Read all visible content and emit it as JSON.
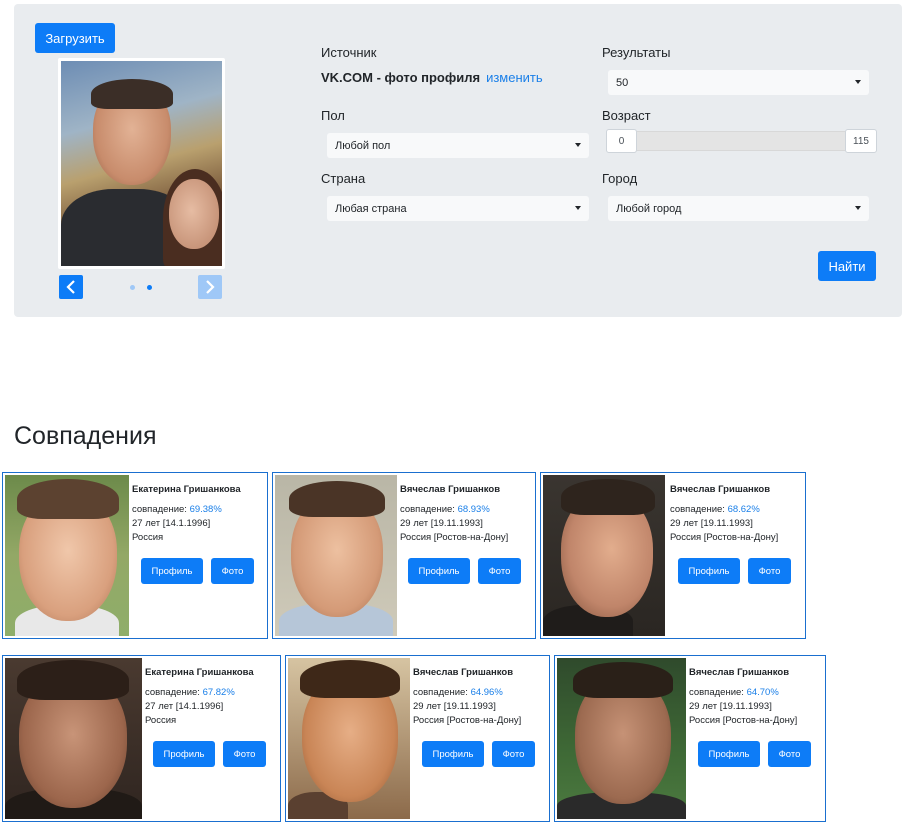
{
  "upload": {
    "label": "Загрузить"
  },
  "carousel": {
    "prev_icon": "chevron-left-icon",
    "next_icon": "chevron-right-icon",
    "dots": 2,
    "active_dot": 1
  },
  "search": {
    "source_label": "Источник",
    "source_value": "VK.COM - фото профиля",
    "source_change": "изменить",
    "results_label": "Результаты",
    "results_value": "50",
    "gender_label": "Пол",
    "gender_value": "Любой пол",
    "age_label": "Возраст",
    "age_min": "0",
    "age_max": "115",
    "country_label": "Страна",
    "country_value": "Любая страна",
    "city_label": "Город",
    "city_value": "Любой город",
    "find_label": "Найти"
  },
  "matches": {
    "heading": "Совпадения",
    "match_prefix": "совпадение:",
    "profile_label": "Профиль",
    "photo_label": "Фото",
    "items": [
      {
        "name": "Екатерина Гришанкова",
        "match": "69.38%",
        "age": "27 лет [14.1.1996]",
        "location": "Россия"
      },
      {
        "name": "Вячеслав Гришанков",
        "match": "68.93%",
        "age": "29 лет [19.11.1993]",
        "location": "Россия [Ростов-на-Дону]"
      },
      {
        "name": "Вячеслав Гришанков",
        "match": "68.62%",
        "age": "29 лет [19.11.1993]",
        "location": "Россия [Ростов-на-Дону]"
      },
      {
        "name": "Екатерина Гришанкова",
        "match": "67.82%",
        "age": "27 лет [14.1.1996]",
        "location": "Россия"
      },
      {
        "name": "Вячеслав Гришанков",
        "match": "64.96%",
        "age": "29 лет [19.11.1993]",
        "location": "Россия [Ростов-на-Дону]"
      },
      {
        "name": "Вячеслав Гришанков",
        "match": "64.70%",
        "age": "29 лет [19.11.1993]",
        "location": "Россия [Ростов-на-Дону]"
      }
    ]
  },
  "colors": {
    "primary": "#0d7cf7",
    "panel_bg": "#e9ecef",
    "card_border": "#1a6fcf",
    "match_text": "#1a7fe8"
  }
}
